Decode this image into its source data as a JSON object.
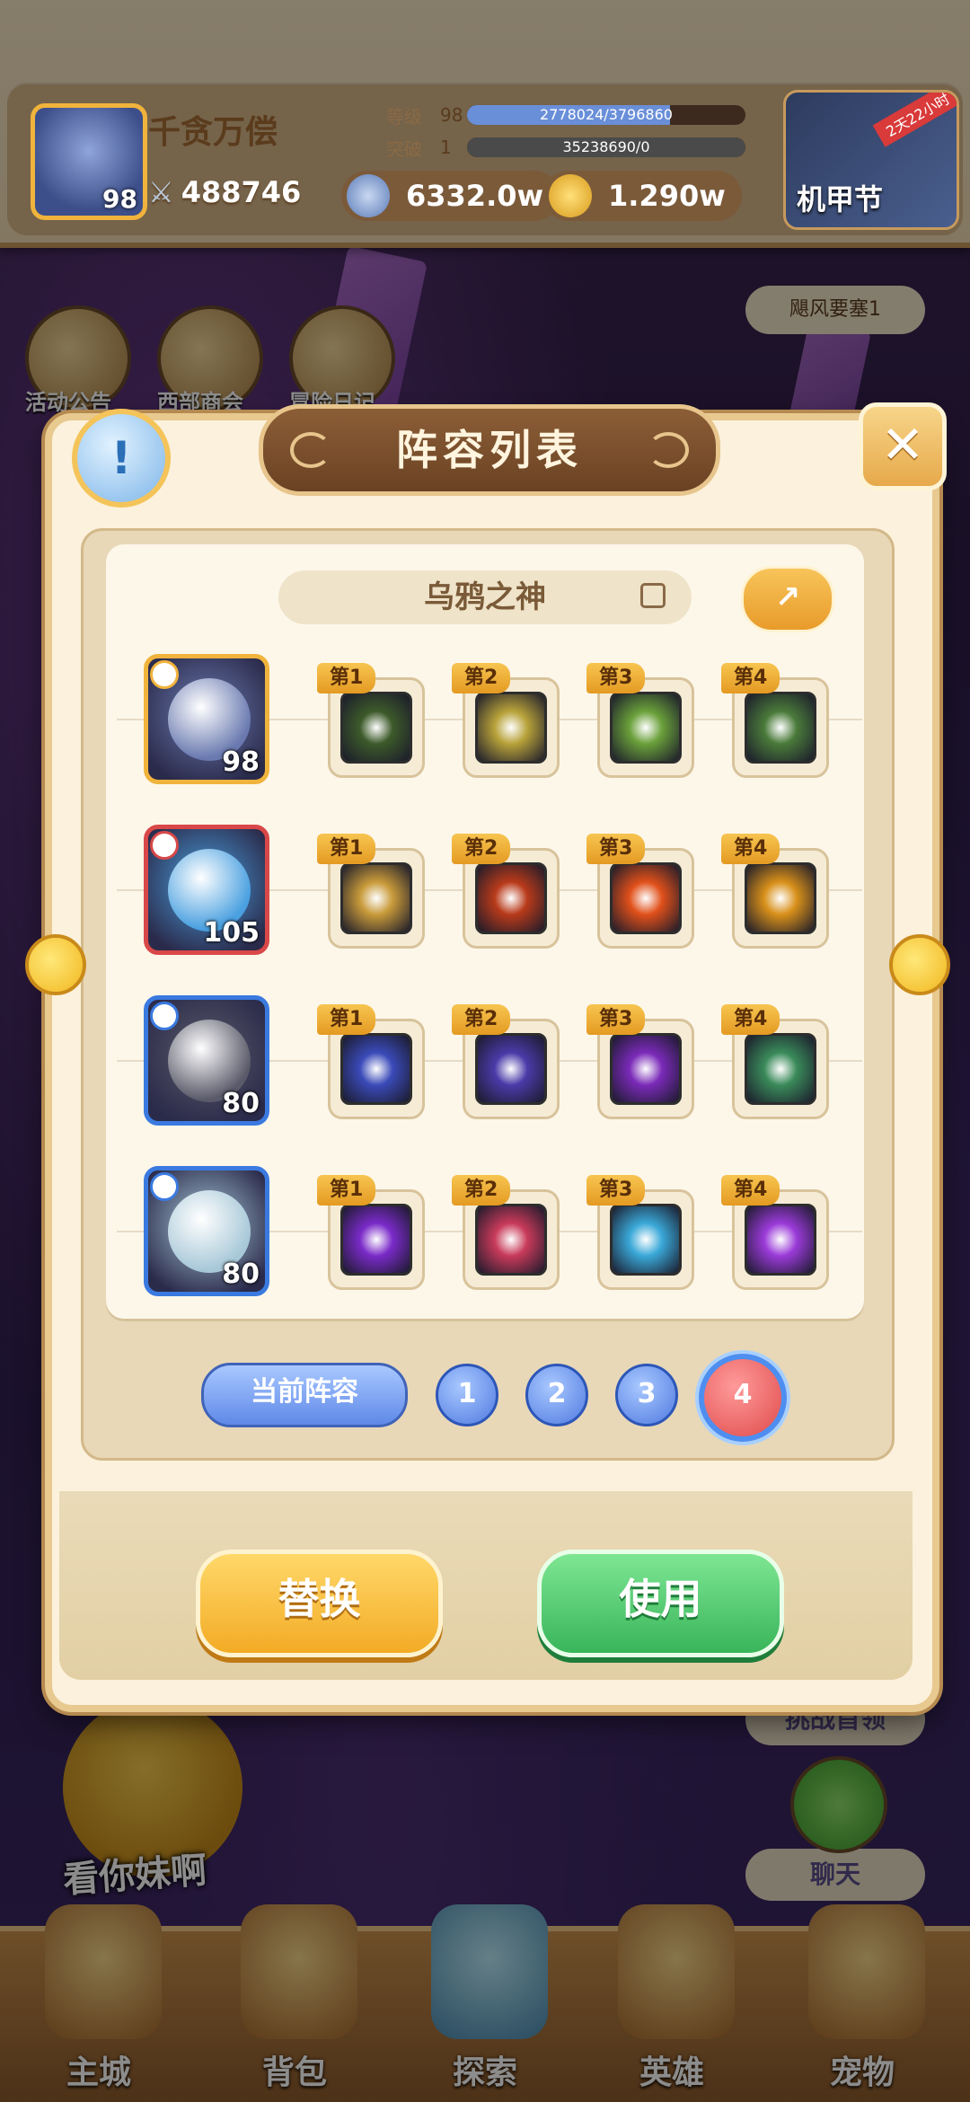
{
  "player": {
    "name": "千贪万偿",
    "level": "98",
    "power": "488746",
    "level_label": "等级",
    "level_num": "98",
    "level_exp": "2778024/3796860",
    "level_exp_fraction": 0.73,
    "break_label": "突破",
    "break_num": "1",
    "break_exp": "35238690/0",
    "break_exp_fraction": 1.0
  },
  "currency": {
    "silver": "6332.0w",
    "gold": "1.290w"
  },
  "event": {
    "title": "机甲节",
    "ribbon": "2天22小时"
  },
  "side_menu": [
    {
      "label": "活动公告"
    },
    {
      "label": "西部商会"
    },
    {
      "label": "冒险日记"
    }
  ],
  "zone_tag": "飓风要塞1",
  "right_buttons": {
    "challenge": "挑战首领",
    "chat": "聊天"
  },
  "mascot_text": "看你妹啊",
  "bottom_nav": [
    {
      "label": "主城"
    },
    {
      "label": "背包"
    },
    {
      "label": "探索"
    },
    {
      "label": "英雄"
    },
    {
      "label": "宠物"
    }
  ],
  "dialog": {
    "title": "阵容列表",
    "info_label": "!",
    "close_label": "✕",
    "team_name": "乌鸦之神",
    "share_label": "↗",
    "heroes": [
      {
        "level": "98",
        "colors": [
          "#f0b33c",
          "#6a7ab0"
        ],
        "skills": [
          {
            "tag": "第1",
            "color": "#3d5a2a"
          },
          {
            "tag": "第2",
            "color": "#b8a23a"
          },
          {
            "tag": "第3",
            "color": "#6aa03a"
          },
          {
            "tag": "第4",
            "color": "#4a7a3a"
          }
        ]
      },
      {
        "level": "105",
        "colors": [
          "#d84848",
          "#4aa0e0"
        ],
        "skills": [
          {
            "tag": "第1",
            "color": "#c89a3a"
          },
          {
            "tag": "第2",
            "color": "#b83a1a"
          },
          {
            "tag": "第3",
            "color": "#e0501a"
          },
          {
            "tag": "第4",
            "color": "#d8901a"
          }
        ]
      },
      {
        "level": "80",
        "colors": [
          "#3a7ae0",
          "#5a5a6a"
        ],
        "skills": [
          {
            "tag": "第1",
            "color": "#3a4ab8"
          },
          {
            "tag": "第2",
            "color": "#4a3aa8"
          },
          {
            "tag": "第3",
            "color": "#7a2ab8"
          },
          {
            "tag": "第4",
            "color": "#3a8a5a"
          }
        ]
      },
      {
        "level": "80",
        "colors": [
          "#3a7ae0",
          "#a8c8d8"
        ],
        "skills": [
          {
            "tag": "第1",
            "color": "#7a2ac8"
          },
          {
            "tag": "第2",
            "color": "#c83a5a"
          },
          {
            "tag": "第3",
            "color": "#3aa8d8"
          },
          {
            "tag": "第4",
            "color": "#9a3ad8"
          }
        ]
      }
    ],
    "current_label": "当前阵容",
    "presets": [
      "1",
      "2",
      "3",
      "4"
    ],
    "active_preset": "4",
    "replace_label": "替换",
    "use_label": "使用"
  }
}
